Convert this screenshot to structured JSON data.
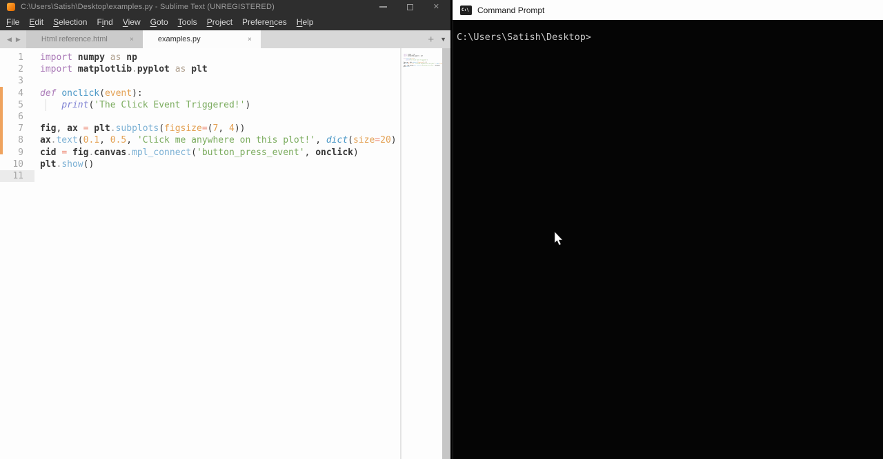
{
  "sublime": {
    "title": "C:\\Users\\Satish\\Desktop\\examples.py - Sublime Text (UNREGISTERED)",
    "menu": [
      {
        "label": "File",
        "accel": 0
      },
      {
        "label": "Edit",
        "accel": 0
      },
      {
        "label": "Selection",
        "accel": 0
      },
      {
        "label": "Find",
        "accel": 1
      },
      {
        "label": "View",
        "accel": 0
      },
      {
        "label": "Goto",
        "accel": 0
      },
      {
        "label": "Tools",
        "accel": 0
      },
      {
        "label": "Project",
        "accel": 0
      },
      {
        "label": "Preferences",
        "accel": 7
      },
      {
        "label": "Help",
        "accel": 0
      }
    ],
    "tabs": [
      {
        "label": "Html reference.html",
        "active": false
      },
      {
        "label": "examples.py",
        "active": true
      }
    ],
    "glyphs": {
      "back": "◀",
      "forward": "▶",
      "close": "×",
      "plus": "+",
      "overflow": "▼",
      "window_close": "✕"
    },
    "editor": {
      "current_line": 11,
      "lines": [
        {
          "segs": [
            [
              "kw",
              "import"
            ],
            [
              "pln",
              " "
            ],
            [
              "id",
              "numpy"
            ],
            [
              "pln",
              " "
            ],
            [
              "kw2",
              "as"
            ],
            [
              "pln",
              " "
            ],
            [
              "id",
              "np"
            ]
          ]
        },
        {
          "segs": [
            [
              "kw",
              "import"
            ],
            [
              "pln",
              " "
            ],
            [
              "id",
              "matplotlib"
            ],
            [
              "dot",
              "."
            ],
            [
              "id",
              "pyplot"
            ],
            [
              "pln",
              " "
            ],
            [
              "kw2",
              "as"
            ],
            [
              "pln",
              " "
            ],
            [
              "id",
              "plt"
            ]
          ]
        },
        {
          "segs": []
        },
        {
          "segs": [
            [
              "kwit",
              "def"
            ],
            [
              "pln",
              " "
            ],
            [
              "fn",
              "onclick"
            ],
            [
              "pun",
              "("
            ],
            [
              "arg",
              "event"
            ],
            [
              "pun",
              "):"
            ]
          ]
        },
        {
          "segs": [
            [
              "pln",
              "    "
            ],
            [
              "prt",
              "print"
            ],
            [
              "pun",
              "("
            ],
            [
              "str",
              "'The Click Event Triggered!'"
            ],
            [
              "pun",
              ")"
            ]
          ]
        },
        {
          "segs": []
        },
        {
          "segs": [
            [
              "id",
              "fig"
            ],
            [
              "pun",
              ","
            ],
            [
              "pln",
              " "
            ],
            [
              "id",
              "ax"
            ],
            [
              "pln",
              " "
            ],
            [
              "op",
              "="
            ],
            [
              "pln",
              " "
            ],
            [
              "id",
              "plt"
            ],
            [
              "dot",
              "."
            ],
            [
              "fncall",
              "subplots"
            ],
            [
              "pun",
              "("
            ],
            [
              "arg",
              "figsize"
            ],
            [
              "op",
              "="
            ],
            [
              "pun",
              "("
            ],
            [
              "num",
              "7"
            ],
            [
              "pun",
              ","
            ],
            [
              "pln",
              " "
            ],
            [
              "num",
              "4"
            ],
            [
              "pun",
              "))"
            ]
          ]
        },
        {
          "segs": [
            [
              "id",
              "ax"
            ],
            [
              "dot",
              "."
            ],
            [
              "fncall",
              "text"
            ],
            [
              "pun",
              "("
            ],
            [
              "num",
              "0.1"
            ],
            [
              "pun",
              ","
            ],
            [
              "pln",
              " "
            ],
            [
              "num",
              "0.5"
            ],
            [
              "pun",
              ","
            ],
            [
              "pln",
              " "
            ],
            [
              "str",
              "'Click me anywhere on this plot!'"
            ],
            [
              "pun",
              ","
            ],
            [
              "pln",
              " "
            ],
            [
              "fnit",
              "dict"
            ],
            [
              "pun",
              "("
            ],
            [
              "arg",
              "size"
            ],
            [
              "op",
              "="
            ],
            [
              "num",
              "20"
            ],
            [
              "pun",
              ")"
            ]
          ]
        },
        {
          "segs": [
            [
              "id",
              "cid"
            ],
            [
              "pln",
              " "
            ],
            [
              "op",
              "="
            ],
            [
              "pln",
              " "
            ],
            [
              "id",
              "fig"
            ],
            [
              "dot",
              "."
            ],
            [
              "id",
              "canvas"
            ],
            [
              "dot",
              "."
            ],
            [
              "fncall",
              "mpl_connect"
            ],
            [
              "pun",
              "("
            ],
            [
              "str",
              "'button_press_event'"
            ],
            [
              "pun",
              ","
            ],
            [
              "pln",
              " "
            ],
            [
              "id",
              "onclick"
            ],
            [
              "pun",
              ")"
            ]
          ]
        },
        {
          "segs": [
            [
              "id",
              "plt"
            ],
            [
              "dot",
              "."
            ],
            [
              "fncall",
              "show"
            ],
            [
              "pun",
              "()"
            ]
          ]
        },
        {
          "segs": []
        }
      ]
    }
  },
  "cmd": {
    "title": "Command Prompt",
    "icon_label": "C:\\",
    "prompt": "C:\\Users\\Satish\\Desktop>"
  },
  "colors": {
    "syntax": {
      "kw": "#ab7bb8",
      "kwit": "#ab7bb8",
      "kw2": "#b0a190",
      "id": "#383838",
      "pln": "#383838",
      "dot": "#9a9a9a",
      "fn": "#4a97c6",
      "fncall": "#7bb0d4",
      "fnit": "#4a97c6",
      "prt": "#7d80d2",
      "arg": "#e3a052",
      "num": "#e3a052",
      "str": "#7aab5d",
      "op": "#ee8e7a",
      "pun": "#383838"
    },
    "modified_marker": "#efa35e",
    "console_bg": "#050505",
    "console_text": "#c8c8c8",
    "titlebar_bg": "#2e2e2e"
  }
}
